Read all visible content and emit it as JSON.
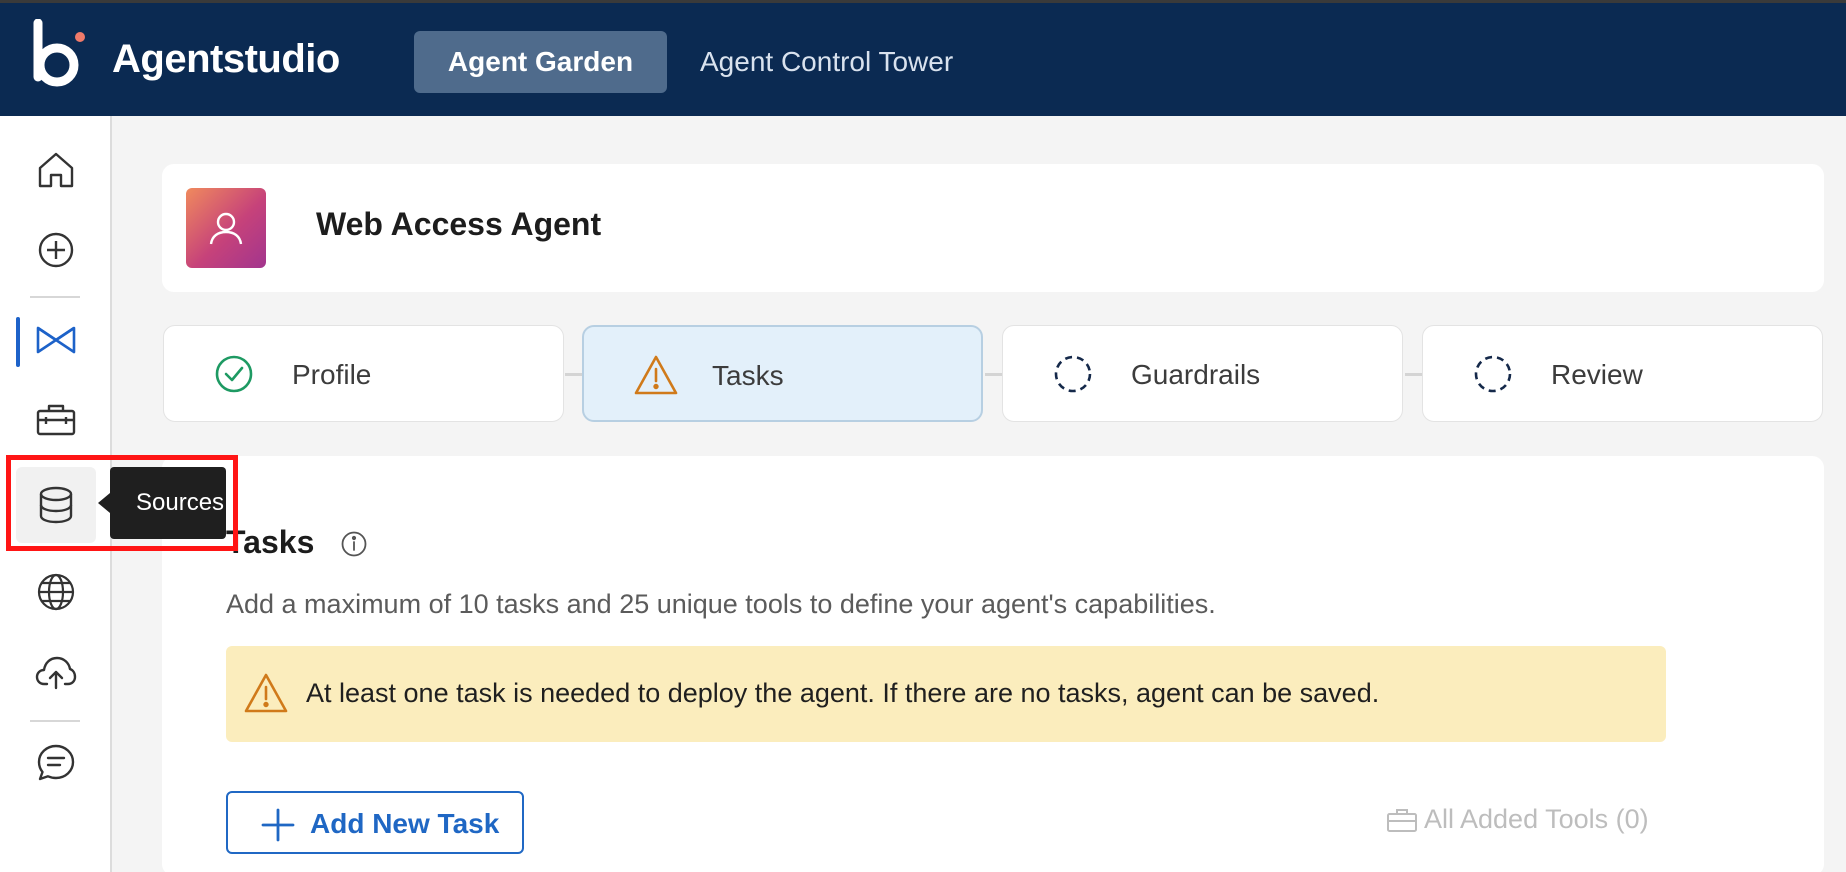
{
  "app": {
    "brand": "Agentstudio",
    "nav_tabs": [
      {
        "label": "Agent Garden",
        "active": true
      },
      {
        "label": "Agent Control Tower",
        "active": false
      }
    ]
  },
  "sidebar": {
    "items": [
      {
        "icon": "home-icon"
      },
      {
        "icon": "plus-circle-icon"
      },
      {
        "icon": "bowtie-icon",
        "active": true
      },
      {
        "icon": "briefcase-icon"
      },
      {
        "icon": "database-icon",
        "hovered": true
      },
      {
        "icon": "globe-icon"
      },
      {
        "icon": "cloud-upload-icon"
      },
      {
        "icon": "chat-icon"
      }
    ],
    "tooltip": "Sources"
  },
  "agent": {
    "name": "Web Access Agent"
  },
  "steps": [
    {
      "label": "Profile",
      "status": "complete"
    },
    {
      "label": "Tasks",
      "status": "warning"
    },
    {
      "label": "Guardrails",
      "status": "pending"
    },
    {
      "label": "Review",
      "status": "pending"
    }
  ],
  "tasks_section": {
    "title": "Tasks",
    "description": "Add a maximum of 10 tasks and 25 unique tools to define your agent's capabilities.",
    "warning": "At least one task is needed to deploy the agent. If there are no tasks, agent can be saved.",
    "add_button": "Add New Task",
    "all_tools": "All Added Tools (0)"
  },
  "colors": {
    "topbar": "#0b2a52",
    "accent": "#1f67c4",
    "warning_bg": "#fbedbd",
    "warning_icon": "#d07a1a",
    "success": "#1e9a63",
    "highlight": "#ff1515"
  }
}
